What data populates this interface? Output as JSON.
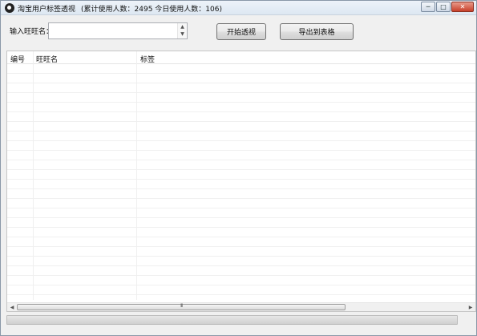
{
  "window": {
    "title": "淘宝用户标签透视",
    "stats": "(累计使用人数：2495    今日使用人数：106)",
    "icon": "app-logo-icon",
    "controls": {
      "minimize": "─",
      "maximize": "□",
      "close": "✕"
    }
  },
  "form": {
    "name_label": "输入旺旺名：",
    "name_value": "",
    "spin_up": "▲",
    "spin_down": "▼",
    "start_button": "开始透视",
    "export_button": "导出到表格"
  },
  "table": {
    "columns": [
      "编号",
      "旺旺名",
      "标签"
    ],
    "rows": []
  },
  "scrollbar": {
    "left_arrow": "◀",
    "right_arrow": "▶",
    "grip": "III"
  },
  "progress": {
    "value": 0
  },
  "colors": {
    "progress_fill": "#06b025",
    "close_button": "#c7402a"
  }
}
